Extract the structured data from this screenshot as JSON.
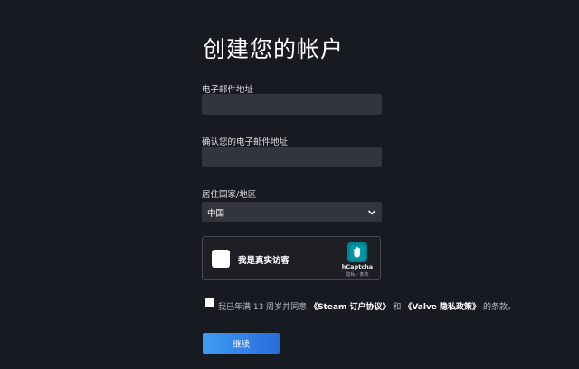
{
  "page_title": "创建您的帐户",
  "email": {
    "label": "电子邮件地址",
    "value": ""
  },
  "confirm_email": {
    "label": "确认您的电子邮件地址",
    "value": ""
  },
  "country": {
    "label": "居住国家/地区",
    "selected": "中国"
  },
  "captcha": {
    "prompt": "我是真实访客",
    "brand": "hCaptcha",
    "links": "隐私 - 条款"
  },
  "agreement": {
    "prefix": "我已年满 13 周岁并同意",
    "steam_link": "《Steam 订户协议》",
    "conjunction": "和",
    "valve_link": "《Valve 隐私政策》",
    "suffix": "的条款。"
  },
  "continue_label": "继续",
  "colors": {
    "background": "#181a21",
    "input_bg": "#32353c",
    "button_start": "#3f9df3",
    "button_end": "#2a6bdc",
    "hcaptcha_teal": "#00838f"
  }
}
